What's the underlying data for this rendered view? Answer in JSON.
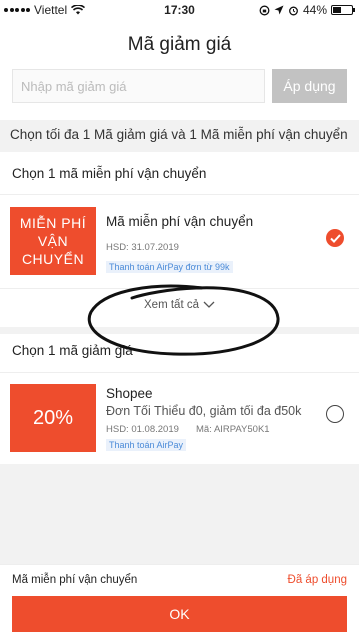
{
  "status_bar": {
    "carrier": "Viettel",
    "time": "17:30",
    "battery": "44%",
    "battery_level": 0.44
  },
  "header": {
    "title": "Mã giảm giá",
    "input_placeholder": "Nhập mã giảm giá",
    "input_value": "",
    "apply_label": "Áp dụng"
  },
  "instruction": "Chọn tối đa 1 Mã giảm giá và 1 Mã miễn phí vận chuyển",
  "freeship_section": {
    "title": "Chọn 1 mã miễn phí vận chuyển",
    "voucher": {
      "badge_text": "MIỄN PHÍ VẬN CHUYỂN",
      "name": "Mã miễn phí vận chuyển",
      "expiry": "HSD: 31.07.2019",
      "tag": "Thanh toán AirPay đơn từ 99k",
      "selected": true
    },
    "see_all_label": "Xem tất cả"
  },
  "discount_section": {
    "title": "Chọn 1 mã giảm giá",
    "voucher": {
      "badge_text": "20%",
      "name": "Shopee",
      "description": "Đơn Tối Thiểu đ0, giảm tối đa đ50k",
      "expiry": "HSD: 01.08.2019",
      "code": "Mã: AIRPAY50K1",
      "tag": "Thanh toán AirPay",
      "selected": false
    }
  },
  "footer": {
    "label": "Mã miễn phí vận chuyển",
    "status": "Đã áp dụng",
    "ok_label": "OK"
  },
  "colors": {
    "accent": "#ee4d2d",
    "link": "#4c8bd8",
    "disabled_button": "#c2c2c2"
  }
}
